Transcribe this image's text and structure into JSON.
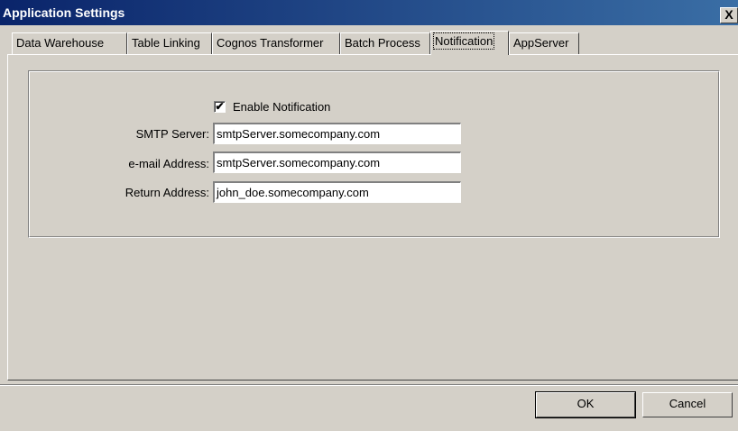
{
  "window": {
    "title": "Application Settings",
    "close_label": "X"
  },
  "tabs": [
    {
      "label": "Data Warehouse"
    },
    {
      "label": "Table Linking"
    },
    {
      "label": "Cognos Transformer"
    },
    {
      "label": "Batch Process"
    },
    {
      "label": "Notification",
      "active": true
    },
    {
      "label": "AppServer"
    }
  ],
  "notification": {
    "enable_label": "Enable Notification",
    "enable_checked": true,
    "check_glyph": "✔",
    "smtp_label": "SMTP Server:",
    "smtp_value": "smtpServer.somecompany.com",
    "email_label": "e-mail Address:",
    "email_value": "smtpServer.somecompany.com",
    "return_label": "Return Address:",
    "return_value": "john_doe.somecompany.com"
  },
  "buttons": {
    "ok": "OK",
    "cancel": "Cancel"
  }
}
